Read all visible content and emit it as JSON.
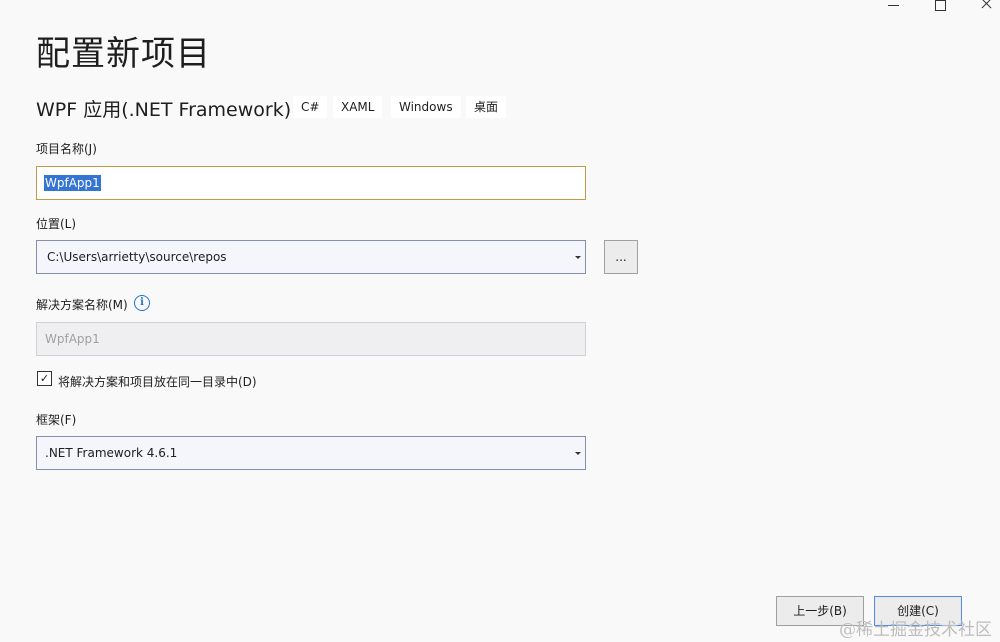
{
  "window_controls": {
    "minimize": "minimize",
    "maximize": "maximize",
    "close": "close"
  },
  "page": {
    "title": "配置新项目"
  },
  "template": {
    "name": "WPF 应用(.NET Framework)",
    "tags": [
      "C#",
      "XAML",
      "Windows",
      "桌面"
    ]
  },
  "project_name": {
    "label": "项目名称(J)",
    "value": "WpfApp1"
  },
  "location": {
    "label": "位置(L)",
    "value": "C:\\Users\\arrietty\\source\\repos",
    "browse_label": "..."
  },
  "solution_name": {
    "label": "解决方案名称(M)",
    "value": "WpfApp1",
    "info_glyph": "i"
  },
  "same_dir": {
    "label": "将解决方案和项目放在同一目录中(D)",
    "checked": true,
    "check_glyph": "✓"
  },
  "framework": {
    "label": "框架(F)",
    "value": ".NET Framework 4.6.1"
  },
  "buttons": {
    "back": "上一步(B)",
    "create": "创建(C)"
  },
  "watermark": "@稀土掘金技术社区",
  "colors": {
    "selection": "#3474d3",
    "focus_border": "#c59a45",
    "primary_border": "#5b8ed4",
    "info": "#1e74d0"
  }
}
